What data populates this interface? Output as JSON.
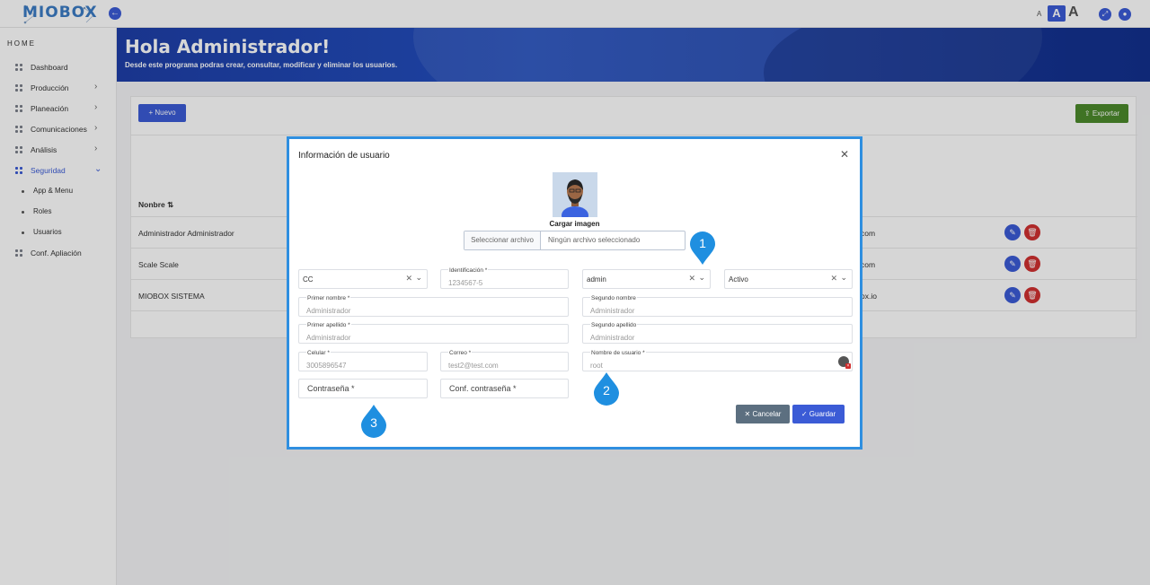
{
  "topbar": {
    "logo_text": "MIOBOX",
    "font_small": "A",
    "font_medium": "A",
    "font_large": "A"
  },
  "sidebar": {
    "home": "HOME",
    "items": [
      {
        "label": "Dashboard"
      },
      {
        "label": "Producción"
      },
      {
        "label": "Planeación"
      },
      {
        "label": "Comunicaciones"
      },
      {
        "label": "Análisis"
      },
      {
        "label": "Seguridad"
      },
      {
        "label": "App & Menu"
      },
      {
        "label": "Roles"
      },
      {
        "label": "Usuarios"
      },
      {
        "label": "Conf. Apliación"
      }
    ]
  },
  "banner": {
    "title": "Hola Administrador!",
    "subtitle": "Desde este programa podras crear, consultar, modificar y eliminar los usuarios."
  },
  "toolbar": {
    "new_label": "Nuevo",
    "export_label": "Exportar"
  },
  "table": {
    "header_name": "Nonbre",
    "rows": [
      {
        "name": "Administrador Administrador",
        "mail_tail": "com"
      },
      {
        "name": "Scale Scale",
        "mail_tail": "com"
      },
      {
        "name": "MIOBOX SISTEMA",
        "mail_tail": "ox.io"
      }
    ]
  },
  "modal": {
    "title": "Información de usuario",
    "upload_label": "Cargar imagen",
    "file_button": "Seleccionar archivo",
    "file_status": "Ningún archivo seleccionado",
    "doc_type": "CC",
    "id_label": "Identificación *",
    "id_value": "1234567-5",
    "role": "admin",
    "status": "Activo",
    "first_name_label": "Primer nombre *",
    "first_name": "Administrador",
    "second_name_label": "Segundo nombre",
    "second_name": "Administrador",
    "first_last_label": "Primer apellido *",
    "first_last": "Administrador",
    "second_last_label": "Segundo apellido",
    "second_last": "Administrador",
    "phone_label": "Celular *",
    "phone": "3005896547",
    "email_label": "Correo *",
    "email": "test2@test.com",
    "username_label": "Nombre de usuario *",
    "username": "root",
    "password_ph": "Contraseña *",
    "confirm_ph": "Conf. contraseña *",
    "cancel_label": "Cancelar",
    "save_label": "Guardar"
  },
  "markers": [
    "1",
    "2",
    "3"
  ],
  "colors": {
    "primary": "#3b5bd6",
    "export": "#4c8a2c",
    "danger": "#d03030",
    "cancel": "#5c6f80",
    "marker": "#1f8fe0"
  },
  "icons": [
    "collapse-arrow-icon",
    "expand-icon",
    "user-icon",
    "plus-icon",
    "upload-icon",
    "edit-icon",
    "trash-icon",
    "close-icon",
    "check-icon",
    "sort-icon",
    "chevron-right-icon",
    "chevron-down-icon"
  ]
}
